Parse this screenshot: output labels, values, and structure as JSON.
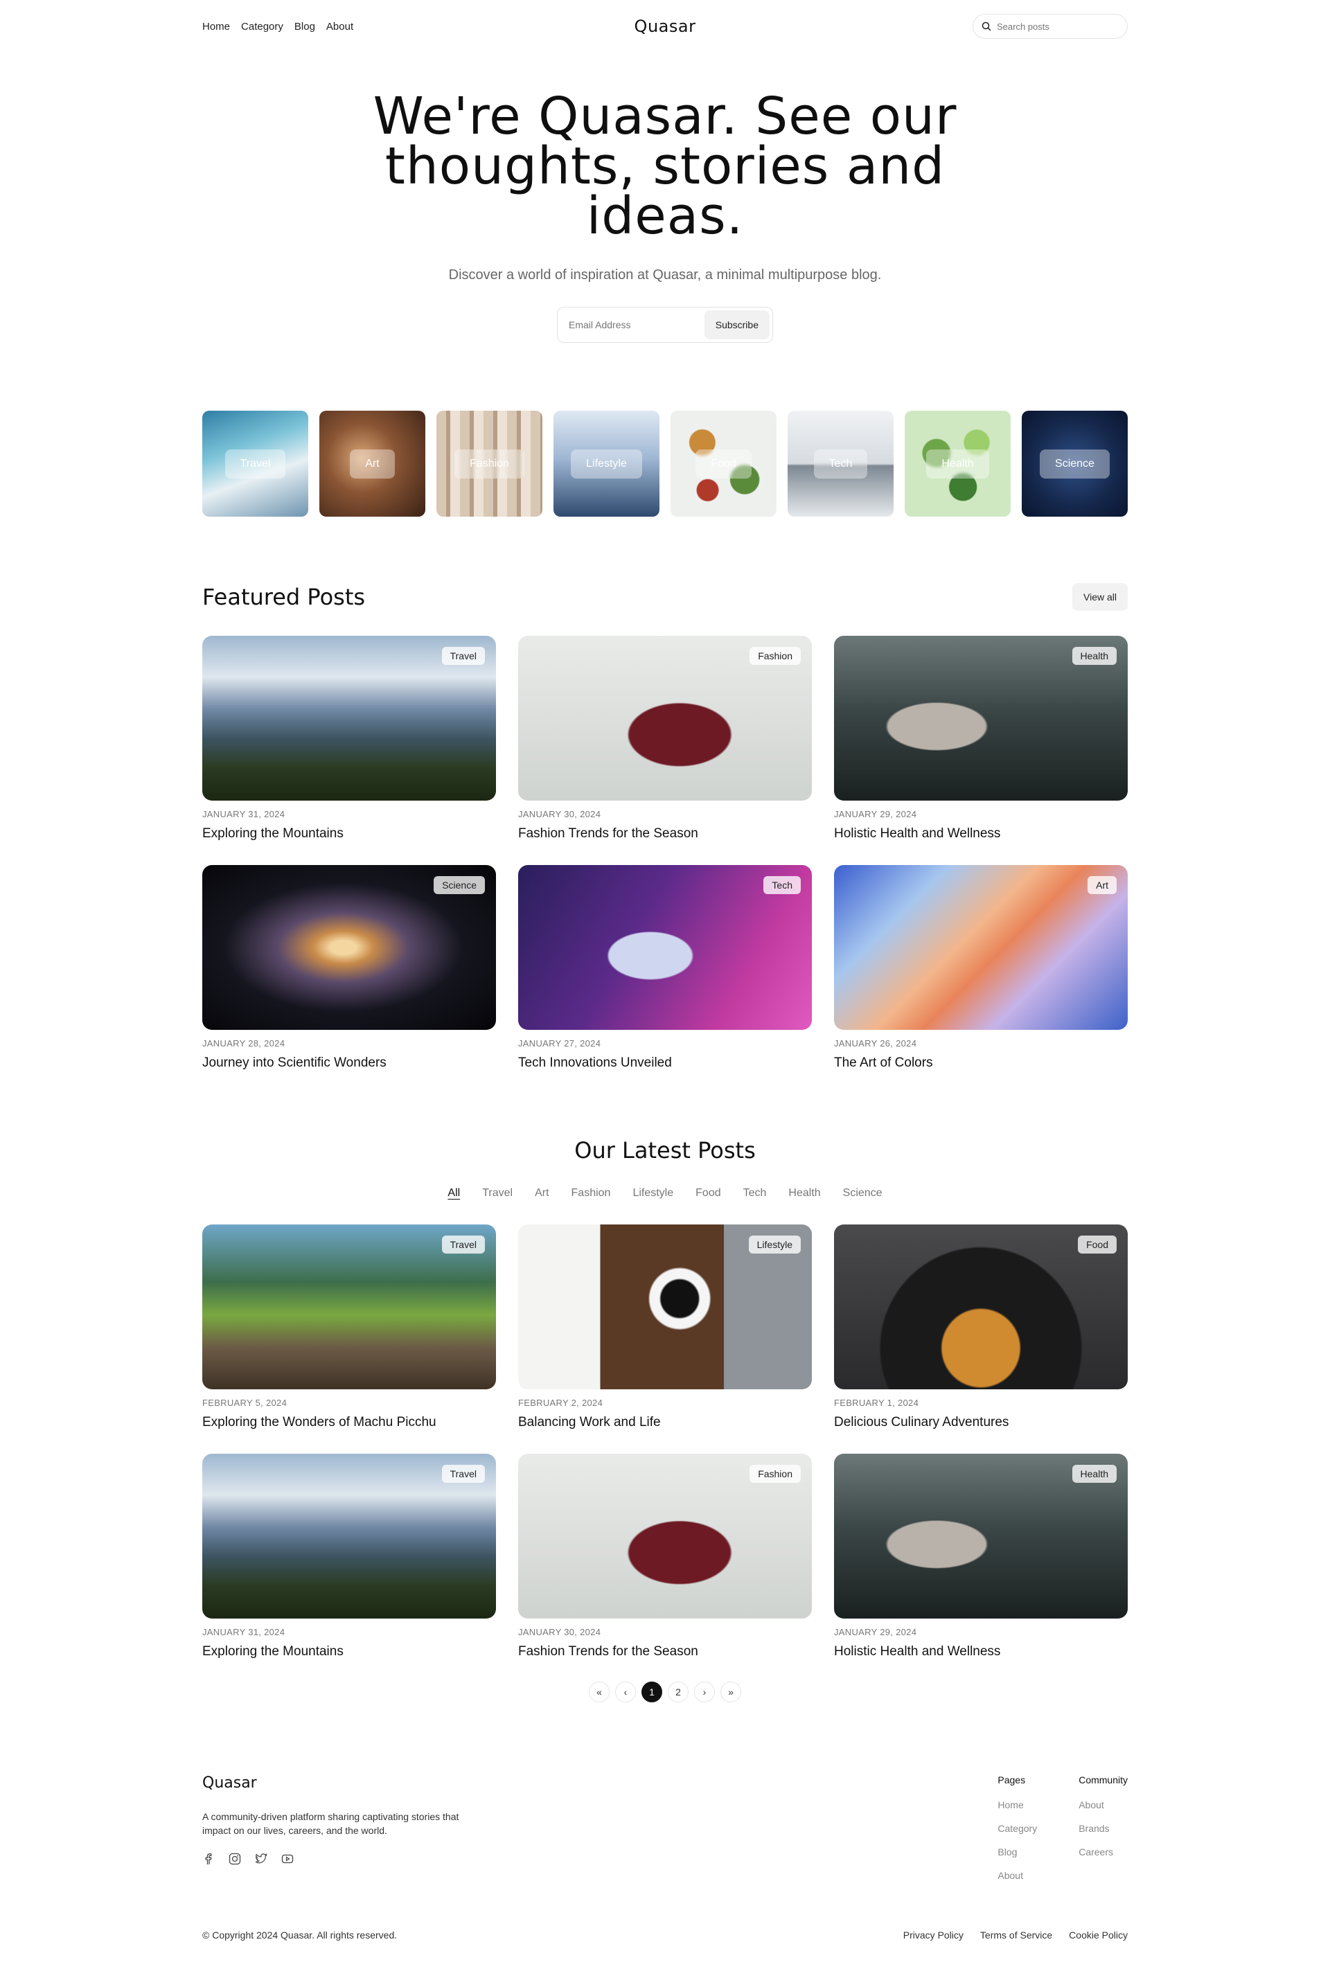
{
  "nav": {
    "items": [
      "Home",
      "Category",
      "Blog",
      "About"
    ]
  },
  "brand": "Quasar",
  "search": {
    "placeholder": "Search posts"
  },
  "hero": {
    "title": "We're Quasar. See our thoughts, stories and ideas.",
    "subtitle": "Discover a world of inspiration at Quasar, a minimal multipurpose blog.",
    "email_placeholder": "Email Address",
    "subscribe_label": "Subscribe"
  },
  "categories": [
    "Travel",
    "Art",
    "Fashion",
    "Lifestyle",
    "Food",
    "Tech",
    "Health",
    "Science"
  ],
  "featured": {
    "title": "Featured Posts",
    "view_all": "View all",
    "posts": [
      {
        "category": "Travel",
        "date": "JANUARY 31, 2024",
        "title": "Exploring the Mountains"
      },
      {
        "category": "Fashion",
        "date": "JANUARY 30, 2024",
        "title": "Fashion Trends for the Season"
      },
      {
        "category": "Health",
        "date": "JANUARY 29, 2024",
        "title": "Holistic Health and Wellness"
      },
      {
        "category": "Science",
        "date": "JANUARY 28, 2024",
        "title": "Journey into Scientific Wonders"
      },
      {
        "category": "Tech",
        "date": "JANUARY 27, 2024",
        "title": "Tech Innovations Unveiled"
      },
      {
        "category": "Art",
        "date": "JANUARY 26, 2024",
        "title": "The Art of Colors"
      }
    ]
  },
  "latest": {
    "title": "Our Latest Posts",
    "filters": [
      "All",
      "Travel",
      "Art",
      "Fashion",
      "Lifestyle",
      "Food",
      "Tech",
      "Health",
      "Science"
    ],
    "active_filter": "All",
    "posts": [
      {
        "category": "Travel",
        "date": "FEBRUARY 5, 2024",
        "title": "Exploring the Wonders of Machu Picchu"
      },
      {
        "category": "Lifestyle",
        "date": "FEBRUARY 2, 2024",
        "title": "Balancing Work and Life"
      },
      {
        "category": "Food",
        "date": "FEBRUARY 1, 2024",
        "title": "Delicious Culinary Adventures"
      },
      {
        "category": "Travel",
        "date": "JANUARY 31, 2024",
        "title": "Exploring the Mountains"
      },
      {
        "category": "Fashion",
        "date": "JANUARY 30, 2024",
        "title": "Fashion Trends for the Season"
      },
      {
        "category": "Health",
        "date": "JANUARY 29, 2024",
        "title": "Holistic Health and Wellness"
      }
    ]
  },
  "pagination": {
    "first": "«",
    "prev": "‹",
    "pages": [
      "1",
      "2"
    ],
    "current": "1",
    "next": "›",
    "last": "»"
  },
  "footer": {
    "logo": "Quasar",
    "description": "A community-driven platform sharing captivating stories that impact on our lives, careers, and the world.",
    "social_icons": [
      "facebook-icon",
      "instagram-icon",
      "twitter-icon",
      "youtube-icon"
    ],
    "pages_title": "Pages",
    "pages_links": [
      "Home",
      "Category",
      "Blog",
      "About"
    ],
    "community_title": "Community",
    "community_links": [
      "About",
      "Brands",
      "Careers"
    ],
    "copyright": "© Copyright 2024 Quasar. All rights reserved.",
    "legal_links": [
      "Privacy Policy",
      "Terms of Service",
      "Cookie Policy"
    ]
  }
}
